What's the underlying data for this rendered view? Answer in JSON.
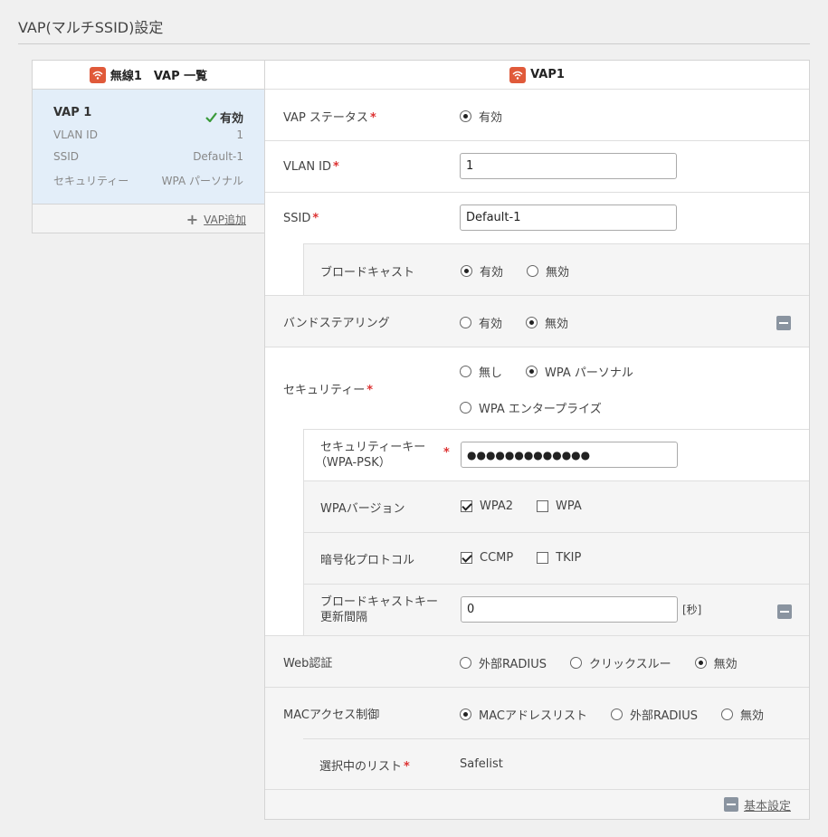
{
  "page": {
    "title": "VAP(マルチSSID)設定"
  },
  "left_panel": {
    "header": "無線1　VAP 一覧",
    "vap": {
      "name": "VAP 1",
      "status": "有効",
      "rows": [
        {
          "label": "VLAN ID",
          "value": "1"
        },
        {
          "label": "SSID",
          "value": "Default-1"
        },
        {
          "label": "セキュリティー",
          "value": "WPA パーソナル"
        }
      ]
    },
    "add_link": "VAP追加"
  },
  "right_panel": {
    "header": "VAP1",
    "vap_status": {
      "label": "VAP ステータス",
      "option": "有効"
    },
    "vlan_id": {
      "label": "VLAN ID",
      "value": "1"
    },
    "ssid": {
      "label": "SSID",
      "value": "Default-1"
    },
    "broadcast": {
      "label": "ブロードキャスト",
      "opt_on": "有効",
      "opt_off": "無効"
    },
    "band_steering": {
      "label": "バンドステアリング",
      "opt_on": "有効",
      "opt_off": "無効"
    },
    "security": {
      "label": "セキュリティー",
      "opt_none": "無し",
      "opt_personal": "WPA パーソナル",
      "opt_enterprise": "WPA エンタープライズ"
    },
    "security_key": {
      "label_line1": "セキュリティーキー",
      "label_line2": "（WPA-PSK）",
      "value": "●●●●●●●●●●●●●"
    },
    "wpa_version": {
      "label": "WPAバージョン",
      "opt_wpa2": "WPA2",
      "opt_wpa": "WPA"
    },
    "cipher": {
      "label": "暗号化プロトコル",
      "opt_ccmp": "CCMP",
      "opt_tkip": "TKIP"
    },
    "rekey": {
      "label_line1": "ブロードキャストキー",
      "label_line2": "更新間隔",
      "value": "0",
      "unit": "[秒]"
    },
    "web_auth": {
      "label": "Web認証",
      "opt_radius": "外部RADIUS",
      "opt_click": "クリックスルー",
      "opt_off": "無効"
    },
    "mac_access": {
      "label": "MACアクセス制御",
      "opt_list": "MACアドレスリスト",
      "opt_radius": "外部RADIUS",
      "opt_off": "無効"
    },
    "selected_list": {
      "label": "選択中のリスト",
      "value": "Safelist"
    },
    "footer_link": "基本設定"
  },
  "colors": {
    "accent_wifi": "#e05a3a",
    "selected_card": "#e3eef9",
    "required": "#d33333",
    "check_green": "#3a9a3a"
  }
}
